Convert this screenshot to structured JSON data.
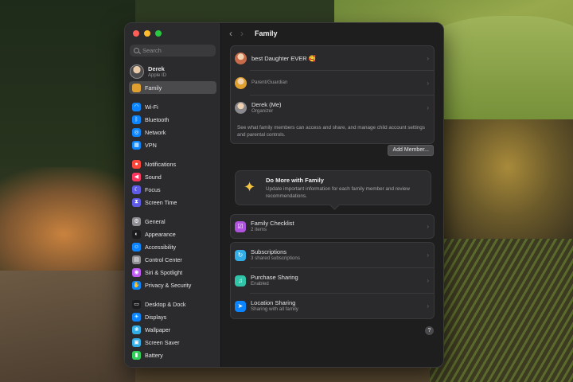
{
  "sidebar": {
    "search_placeholder": "Search",
    "account": {
      "name": "Derek",
      "subtitle": "Apple ID"
    },
    "groups": [
      [
        {
          "label": "Family",
          "icon": "family-icon",
          "color": "#e0a030",
          "selected": true
        }
      ],
      [
        {
          "label": "Wi-Fi",
          "icon": "wifi-icon",
          "color": "#0a84ff",
          "glyph": "◠"
        },
        {
          "label": "Bluetooth",
          "icon": "bluetooth-icon",
          "color": "#0a84ff",
          "glyph": "ᛒ"
        },
        {
          "label": "Network",
          "icon": "network-icon",
          "color": "#0a84ff",
          "glyph": "◎"
        },
        {
          "label": "VPN",
          "icon": "vpn-icon",
          "color": "#0a84ff",
          "glyph": "▦"
        }
      ],
      [
        {
          "label": "Notifications",
          "icon": "bell-icon",
          "color": "#ff453a",
          "glyph": "●"
        },
        {
          "label": "Sound",
          "icon": "speaker-icon",
          "color": "#ff375f",
          "glyph": "◀"
        },
        {
          "label": "Focus",
          "icon": "moon-icon",
          "color": "#5e5ce6",
          "glyph": "☾"
        },
        {
          "label": "Screen Time",
          "icon": "hourglass-icon",
          "color": "#5e5ce6",
          "glyph": "⧗"
        }
      ],
      [
        {
          "label": "General",
          "icon": "gear-icon",
          "color": "#8e8e93",
          "glyph": "⚙"
        },
        {
          "label": "Appearance",
          "icon": "appearance-icon",
          "color": "#1c1c1e",
          "glyph": "◐"
        },
        {
          "label": "Accessibility",
          "icon": "accessibility-icon",
          "color": "#0a84ff",
          "glyph": "☺"
        },
        {
          "label": "Control Center",
          "icon": "control-center-icon",
          "color": "#8e8e93",
          "glyph": "▤"
        },
        {
          "label": "Siri & Spotlight",
          "icon": "siri-icon",
          "color": "#bf5af2",
          "glyph": "◉"
        },
        {
          "label": "Privacy & Security",
          "icon": "hand-icon",
          "color": "#0a84ff",
          "glyph": "✋"
        }
      ],
      [
        {
          "label": "Desktop & Dock",
          "icon": "dock-icon",
          "color": "#1c1c1e",
          "glyph": "▭"
        },
        {
          "label": "Displays",
          "icon": "display-icon",
          "color": "#0a84ff",
          "glyph": "☀"
        },
        {
          "label": "Wallpaper",
          "icon": "wallpaper-icon",
          "color": "#32ade6",
          "glyph": "❀"
        },
        {
          "label": "Screen Saver",
          "icon": "screensaver-icon",
          "color": "#32ade6",
          "glyph": "▣"
        },
        {
          "label": "Battery",
          "icon": "battery-icon",
          "color": "#30d158",
          "glyph": "▮"
        }
      ]
    ]
  },
  "main": {
    "title": "Family",
    "members": [
      {
        "name": "best Daughter EVER 🥰",
        "role": "",
        "avatar_color": "#c66a4a"
      },
      {
        "name": "",
        "role": "Parent/Guardian",
        "avatar_color": "#e0a030"
      },
      {
        "name": "Derek (Me)",
        "role": "Organizer",
        "avatar_color": "#8a8a8e"
      }
    ],
    "members_info": "See what family members can access and share, and manage child account settings and parental controls.",
    "add_member_label": "Add Member...",
    "promo": {
      "title": "Do More with Family",
      "body": "Update important information for each family member and review recommendations."
    },
    "checklist": {
      "title": "Family Checklist",
      "subtitle": "2 items",
      "icon": "checklist-icon",
      "color": "#af52de"
    },
    "features": [
      {
        "title": "Subscriptions",
        "subtitle": "3 shared subscriptions",
        "icon": "subscriptions-icon",
        "color": "#32ade6",
        "glyph": "↻"
      },
      {
        "title": "Purchase Sharing",
        "subtitle": "Enabled",
        "icon": "purchase-sharing-icon",
        "color": "#30c4a8",
        "glyph": "♫"
      },
      {
        "title": "Location Sharing",
        "subtitle": "Sharing with all family",
        "icon": "location-icon",
        "color": "#0a84ff",
        "glyph": "➤"
      }
    ],
    "help_label": "?"
  }
}
